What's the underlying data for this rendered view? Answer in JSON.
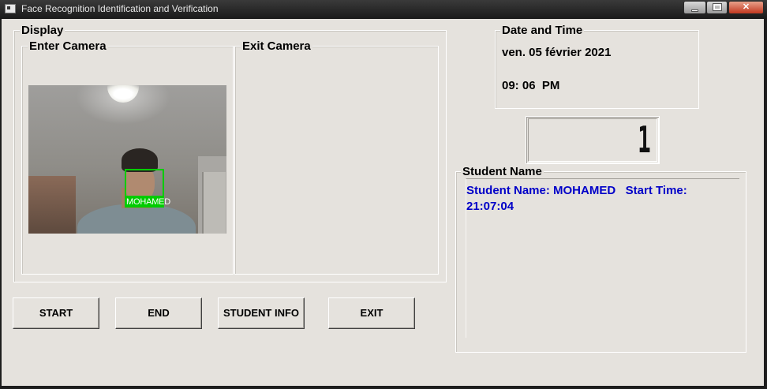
{
  "window": {
    "title": "Face Recognition Identification and Verification"
  },
  "display": {
    "group_title": "Display",
    "enter_camera": {
      "title": "Enter Camera",
      "face_label": "MOHAMED"
    },
    "exit_camera": {
      "title": "Exit Camera"
    }
  },
  "datetime": {
    "group_title": "Date and Time",
    "date": "ven. 05 février 2021",
    "time": "09: 06  PM"
  },
  "counter": {
    "value": "1"
  },
  "student": {
    "group_title": "Student Name",
    "line1": "Student Name: MOHAMED   Start Time:",
    "line2": "21:07:04"
  },
  "buttons": {
    "start": "START",
    "end": "END",
    "student_info": "STUDENT INFO",
    "exit": "EXIT"
  },
  "colors": {
    "student_text": "#0000c8",
    "face_box": "#00cc00",
    "client_bg": "#e5e2dd"
  }
}
